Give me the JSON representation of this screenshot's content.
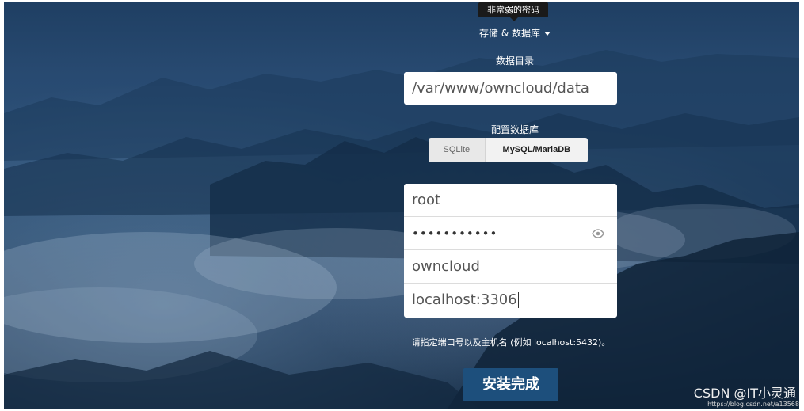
{
  "tooltip": {
    "text": "非常弱的密码"
  },
  "storage": {
    "toggle_label": "存储 & 数据库"
  },
  "datadir": {
    "label": "数据目录",
    "value": "/var/www/owncloud/data"
  },
  "database": {
    "label": "配置数据库",
    "options": [
      "SQLite",
      "MySQL/MariaDB"
    ],
    "selected": "MySQL/MariaDB"
  },
  "credentials": {
    "user": "root",
    "password_mask": "•••••••••••",
    "dbname": "owncloud",
    "host": "localhost:3306"
  },
  "hint": {
    "text": "请指定端口号以及主机名 (例如 localhost:5432)。"
  },
  "submit": {
    "label": "安装完成"
  },
  "watermark": {
    "main": "CSDN @IT小灵通",
    "url": "https://blog.csdn.net/a13568"
  },
  "icons": {
    "caret": "chevron-down-icon",
    "password_toggle": "eye-icon"
  },
  "colors": {
    "background": "#284a71",
    "button": "#1d4f7c",
    "input_bg": "#ffffff"
  }
}
